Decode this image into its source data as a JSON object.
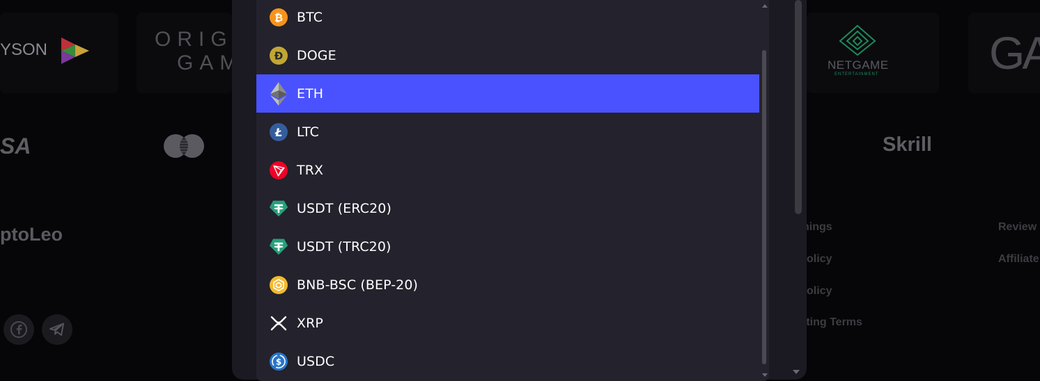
{
  "background": {
    "providers": [
      {
        "text": "YSON"
      },
      {
        "text_line1": "ORIG",
        "text_line2": "GAM"
      },
      {
        "text": "NETGAME",
        "subtext": "ENTERTAINMENT"
      },
      {
        "text": "GA"
      }
    ],
    "payments": [
      "SA",
      "Skrill"
    ],
    "brand": "ptoLeo",
    "footer_links": [
      "nings",
      "olicy",
      "olicy",
      "tting Terms",
      "Review",
      "Affiliate"
    ]
  },
  "dropdown": {
    "selected": "ETH",
    "options": [
      {
        "label": "BTC",
        "icon": "btc-icon",
        "color": "#f7931a"
      },
      {
        "label": "DOGE",
        "icon": "doge-icon",
        "color": "#c2a633"
      },
      {
        "label": "ETH",
        "icon": "eth-icon",
        "color": "#627eea"
      },
      {
        "label": "LTC",
        "icon": "ltc-icon",
        "color": "#345d9d"
      },
      {
        "label": "TRX",
        "icon": "trx-icon",
        "color": "#ef0027"
      },
      {
        "label": "USDT (ERC20)",
        "icon": "usdt-icon",
        "color": "#26a17b"
      },
      {
        "label": "USDT (TRC20)",
        "icon": "usdt-icon",
        "color": "#26a17b"
      },
      {
        "label": "BNB-BSC (BEP-20)",
        "icon": "bnb-icon",
        "color": "#f3ba2f"
      },
      {
        "label": "XRP",
        "icon": "xrp-icon",
        "color": "#ffffff"
      },
      {
        "label": "USDC",
        "icon": "usdc-icon",
        "color": "#2775ca"
      }
    ]
  }
}
